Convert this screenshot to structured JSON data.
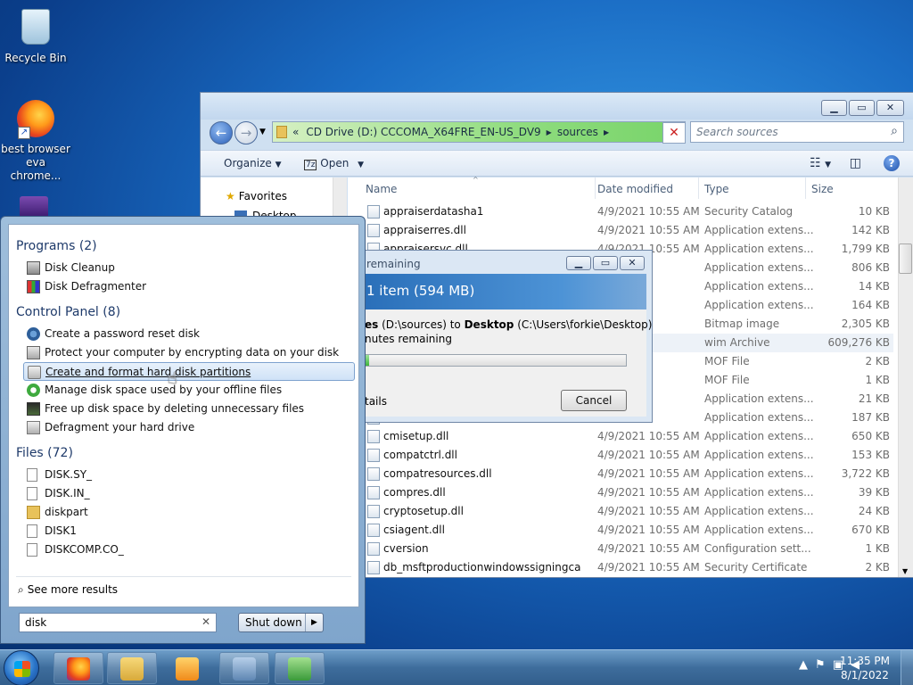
{
  "desktop": {
    "icons": [
      {
        "label": "Recycle Bin",
        "icon": "recycle-bin-icon"
      },
      {
        "label": "best browser\neva chrome...",
        "icon": "firefox-icon"
      }
    ]
  },
  "explorer": {
    "breadcrumb": {
      "prefix": "«",
      "drive": "CD Drive (D:) CCCOMA_X64FRE_EN-US_DV9",
      "folder": "sources"
    },
    "search_placeholder": "Search sources",
    "toolbar": {
      "organize": "Organize",
      "open": "Open"
    },
    "nav": {
      "favorites": "Favorites",
      "desktop": "Desktop"
    },
    "columns": {
      "name": "Name",
      "date": "Date modified",
      "type": "Type",
      "size": "Size"
    },
    "files": [
      {
        "name": "appraiserdatasha1",
        "date": "4/9/2021 10:55 AM",
        "type": "Security Catalog",
        "size": "10 KB"
      },
      {
        "name": "appraiserres.dll",
        "date": "4/9/2021 10:55 AM",
        "type": "Application extens...",
        "size": "142 KB"
      },
      {
        "name": "appraisersvc.dll",
        "date": "4/9/2021 10:55 AM",
        "type": "Application extens...",
        "size": "1,799 KB"
      },
      {
        "name": "",
        "date": "",
        "type": "Application extens...",
        "size": "806 KB"
      },
      {
        "name": "",
        "date": "",
        "type": "Application extens...",
        "size": "14 KB"
      },
      {
        "name": "",
        "date": "",
        "type": "Application extens...",
        "size": "164 KB"
      },
      {
        "name": "",
        "date": "",
        "type": "Bitmap image",
        "size": "2,305 KB"
      },
      {
        "name": "",
        "date": "56 AM",
        "type": "wim Archive",
        "size": "609,276 KB"
      },
      {
        "name": "",
        "date": "",
        "type": "MOF File",
        "size": "2 KB"
      },
      {
        "name": "",
        "date": "",
        "type": "MOF File",
        "size": "1 KB"
      },
      {
        "name": "",
        "date": "",
        "type": "Application extens...",
        "size": "21 KB"
      },
      {
        "name": "",
        "date": "",
        "type": "Application extens...",
        "size": "187 KB"
      },
      {
        "name": "cmisetup.dll",
        "date": "4/9/2021 10:55 AM",
        "type": "Application extens...",
        "size": "650 KB"
      },
      {
        "name": "compatctrl.dll",
        "date": "4/9/2021 10:55 AM",
        "type": "Application extens...",
        "size": "153 KB"
      },
      {
        "name": "compatresources.dll",
        "date": "4/9/2021 10:55 AM",
        "type": "Application extens...",
        "size": "3,722 KB"
      },
      {
        "name": "compres.dll",
        "date": "4/9/2021 10:55 AM",
        "type": "Application extens...",
        "size": "39 KB"
      },
      {
        "name": "cryptosetup.dll",
        "date": "4/9/2021 10:55 AM",
        "type": "Application extens...",
        "size": "24 KB"
      },
      {
        "name": "csiagent.dll",
        "date": "4/9/2021 10:55 AM",
        "type": "Application extens...",
        "size": "670 KB"
      },
      {
        "name": "cversion",
        "date": "4/9/2021 10:55 AM",
        "type": "Configuration sett...",
        "size": "1 KB"
      },
      {
        "name": "db_msftproductionwindowssigningca",
        "date": "4/9/2021 10:55 AM",
        "type": "Security Certificate",
        "size": "2 KB"
      }
    ]
  },
  "copy_dialog": {
    "title": "remaining",
    "banner": "1 item (594 MB)",
    "line1_prefix": "es",
    "line1_from": "(D:\\sources) to",
    "line1_dest": "Desktop",
    "line1_path": "(C:\\Users\\forkie\\Desktop)",
    "line2": "nutes remaining",
    "progress": 0.02,
    "details": "tails",
    "cancel": "Cancel"
  },
  "start_menu": {
    "groups": [
      {
        "header": "Programs (2)",
        "items": [
          "Disk Cleanup",
          "Disk Defragmenter"
        ]
      },
      {
        "header": "Control Panel (8)",
        "items": [
          "Create a password reset disk",
          "Protect your computer by encrypting data on your disk",
          "Create and format hard disk partitions",
          "Manage disk space used by your offline files",
          "Free up disk space by deleting unnecessary files",
          "Defragment your hard drive"
        ]
      },
      {
        "header": "Files (72)",
        "items": [
          "DISK.SY_",
          "DISK.IN_",
          "diskpart",
          "DISK1",
          "DISKCOMP.CO_"
        ]
      }
    ],
    "see_more": "See more results",
    "search_value": "disk",
    "shutdown": "Shut down"
  },
  "taskbar": {
    "clock_time": "11:35 PM",
    "clock_date": "8/1/2022"
  }
}
